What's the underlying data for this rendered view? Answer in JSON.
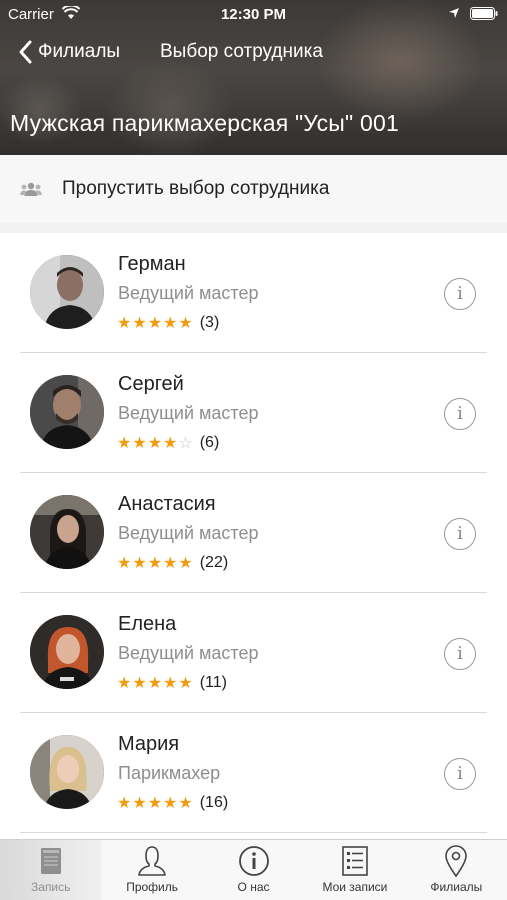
{
  "status_bar": {
    "carrier": "Carrier",
    "time": "12:30 PM"
  },
  "nav": {
    "back_label": "Филиалы",
    "title": "Выбор сотрудника"
  },
  "salon_title": "Мужская парикмахерская \"Усы\" 001",
  "skip": {
    "label": "Пропустить выбор сотрудника",
    "icon": "group-icon"
  },
  "colors": {
    "star": "#f39c12",
    "accent": "#f39c12"
  },
  "staff": [
    {
      "name": "Герман",
      "role": "Ведущий мастер",
      "rating": 5,
      "reviews": "(3)"
    },
    {
      "name": "Сергей",
      "role": "Ведущий мастер",
      "rating": 4,
      "reviews": "(6)"
    },
    {
      "name": "Анастасия",
      "role": "Ведущий мастер",
      "rating": 5,
      "reviews": "(22)"
    },
    {
      "name": "Елена",
      "role": "Ведущий мастер",
      "rating": 5,
      "reviews": "(11)"
    },
    {
      "name": "Мария",
      "role": "Парикмахер",
      "rating": 5,
      "reviews": "(16)"
    }
  ],
  "tabs": [
    {
      "label": "Запись",
      "icon": "book-icon",
      "active": true
    },
    {
      "label": "Профиль",
      "icon": "profile-icon",
      "active": false
    },
    {
      "label": "О нас",
      "icon": "info-icon",
      "active": false
    },
    {
      "label": "Мои записи",
      "icon": "list-icon",
      "active": false
    },
    {
      "label": "Филиалы",
      "icon": "location-pin-icon",
      "active": false
    }
  ]
}
